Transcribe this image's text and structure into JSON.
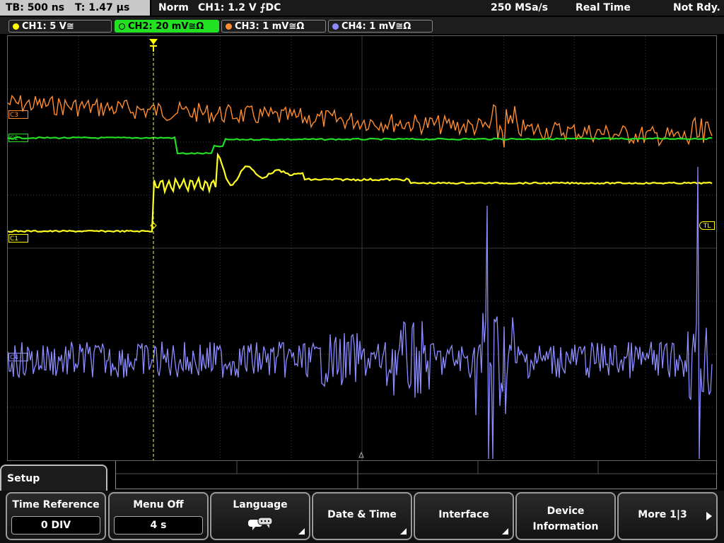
{
  "status": {
    "timebase": "TB: 500 ns",
    "trigger_time": "T: 1.47 µs",
    "mode": "Norm",
    "trigger_source": "CH1: 1.2 V ⨍DC",
    "sample_rate": "250 MSa/s",
    "acq_mode": "Real Time",
    "state": "Not Rdy."
  },
  "channels": [
    {
      "label": "CH1: 5 V≅",
      "color": "#ffff00",
      "active": false
    },
    {
      "label": "CH2: 20 mV≅Ω",
      "color": "#00e000",
      "active": true
    },
    {
      "label": "CH3: 1 mV≅Ω",
      "color": "#ff8c30",
      "active": false
    },
    {
      "label": "CH4: 1 mV≅Ω",
      "color": "#8c8cff",
      "active": false
    }
  ],
  "markers": {
    "c1": "C1",
    "c2": "C2",
    "c3": "C3",
    "c4": "C4",
    "tl": "TL",
    "trigger": "T"
  },
  "menu": {
    "title": "Setup",
    "time_reference_label": "Time Reference",
    "time_reference_value": "0 DIV",
    "menu_off_label": "Menu Off",
    "menu_off_value": "4 s",
    "language_label": "Language",
    "date_time_label": "Date & Time",
    "interface_label": "Interface",
    "device_info_line1": "Device",
    "device_info_line2": "Information",
    "more_label": "More 1|3"
  },
  "colors": {
    "ch1": "#ffff00",
    "ch2": "#00e000",
    "ch3": "#ff8c30",
    "ch4": "#8c8cff",
    "grid": "#3a3a3a"
  }
}
